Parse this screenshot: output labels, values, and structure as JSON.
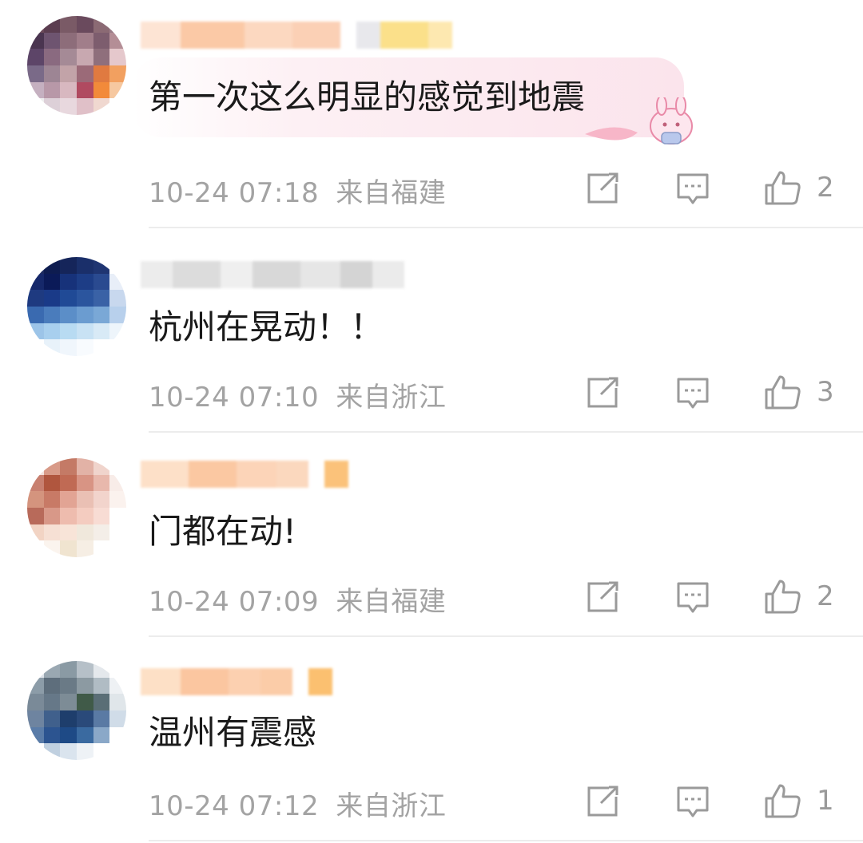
{
  "comments": [
    {
      "text": "第一次这么明显的感觉到地震",
      "time": "10-24 07:18",
      "location": "来自福建",
      "likes": "2",
      "has_sticker_bubble": true
    },
    {
      "text": "杭州在晃动！！",
      "time": "10-24 07:10",
      "location": "来自浙江",
      "likes": "3",
      "has_sticker_bubble": false
    },
    {
      "text": "门都在动!",
      "time": "10-24 07:09",
      "location": "来自福建",
      "likes": "2",
      "has_sticker_bubble": false
    },
    {
      "text": "温州有震感",
      "time": "10-24 07:12",
      "location": "来自浙江",
      "likes": "1",
      "has_sticker_bubble": false
    }
  ],
  "icons": {
    "share": "share-icon",
    "reply": "comment-icon",
    "like": "thumbs-up-icon"
  },
  "colors": {
    "meta_text": "#a3a3a3",
    "icon_stroke": "#9a9a9a",
    "divider": "#ececec",
    "bubble": "#fbe4ec"
  }
}
